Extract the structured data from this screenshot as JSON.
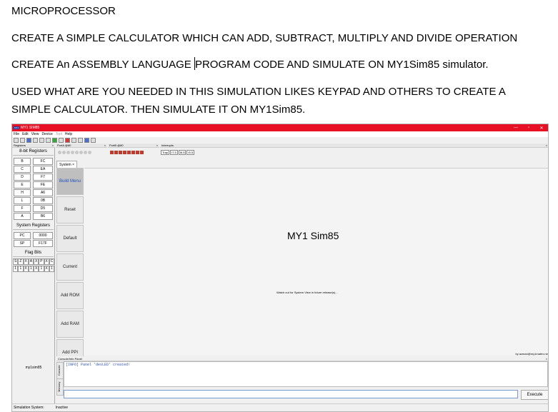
{
  "document": {
    "heading": "MICROPROCESSOR",
    "line1": "CREATE A SIMPLE CALCULATOR WHICH CAN ADD, SUBTRACT, MULTIPLY AND DIVIDE OPERATION",
    "line2_before_caret": "CREATE An ASSEMBLY LANGUAGE ",
    "line2_after_caret": "PROGRAM CODE AND SIMULATE ON MY1Sim85 simulator.",
    "line3": "USED WHAT ARE YOU NEEDED IN THIS SIMULATION LIKES KEYPAD AND OTHERS TO CREATE A",
    "line4": "SIMPLE CALCULATOR. THEN SIMULATE IT ON MY1Sim85."
  },
  "app": {
    "logo_text": "MY1",
    "title": "MY1 SIM85",
    "window_controls": [
      "—",
      "▫",
      "✕"
    ],
    "menu": [
      "File",
      "Edit",
      "View",
      "Device",
      "Tool",
      "Help"
    ],
    "menu_disabled": "Tool",
    "panels": {
      "registers": "Registers",
      "porta": "PortA @80",
      "portb": "PortB @80",
      "interrupts": "Interrupts"
    },
    "interrupt_buttons": [
      "Trap",
      "I7.5",
      "I6.5",
      "I5.5"
    ],
    "registers": {
      "group_8bit": "8-bit Registers",
      "items": [
        {
          "name": "B",
          "value": "FC"
        },
        {
          "name": "C",
          "value": "EA"
        },
        {
          "name": "D",
          "value": "F7"
        },
        {
          "name": "E",
          "value": "FE"
        },
        {
          "name": "H",
          "value": "A6"
        },
        {
          "name": "L",
          "value": "0B"
        },
        {
          "name": "F",
          "value": "D5"
        },
        {
          "name": "A",
          "value": "B6"
        }
      ],
      "group_system": "System Registers",
      "system_items": [
        {
          "name": "PC",
          "value": "0000"
        },
        {
          "name": "SP",
          "value": "F17F"
        }
      ],
      "group_flags": "Flag Bits",
      "flag_names": [
        "S",
        "Z",
        "X",
        "A",
        "X",
        "P",
        "X",
        "C"
      ],
      "flag_values": [
        "1",
        "1",
        "X",
        "1",
        "X",
        "1",
        "X",
        "1"
      ],
      "footer_label": "my1sim85"
    },
    "system_tab": "System",
    "sidebar_buttons": [
      "Build Menu",
      "Reset",
      "Default",
      "Current",
      "Add ROM",
      "Add RAM",
      "Add PPI"
    ],
    "system_view": {
      "title": "MY1 Sim85",
      "notice": "Watch out for System View in future release(s)...",
      "credit": "by azman@my1matrix.net"
    },
    "console": {
      "header": "Console/Info Panel",
      "tabs": [
        "Console",
        "Memory"
      ],
      "log": "[INFO] Panel 'devLED' created!",
      "execute_label": "Execute"
    },
    "status": {
      "label": "Simulation System:",
      "value": "Inactive"
    }
  }
}
